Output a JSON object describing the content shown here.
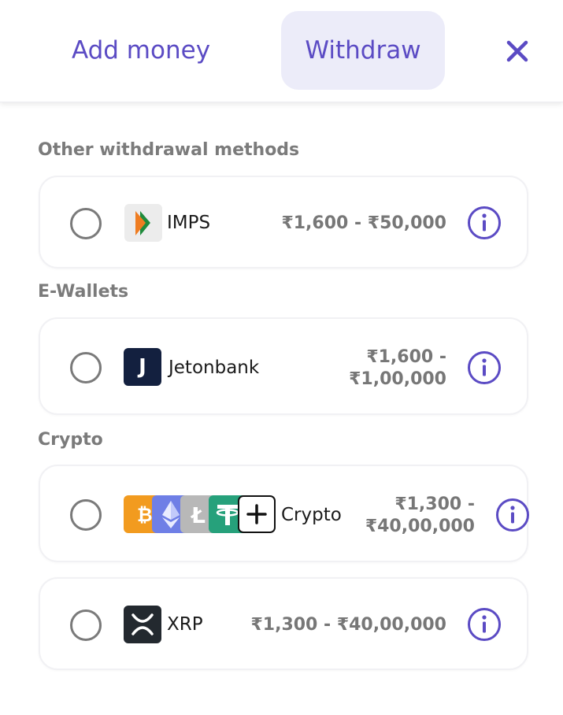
{
  "header": {
    "tabs": [
      {
        "label": "Add money",
        "active": false
      },
      {
        "label": "Withdraw",
        "active": true
      }
    ]
  },
  "sections": {
    "other": {
      "title": "Other withdrawal methods"
    },
    "ewallets": {
      "title": "E-Wallets"
    },
    "crypto": {
      "title": "Crypto"
    }
  },
  "methods": {
    "imps": {
      "name": "IMPS",
      "range": "₹1,600 - ₹50,000",
      "icon": "imps-logo-icon"
    },
    "jetonbank": {
      "name": "Jetonbank",
      "range_line1": "₹1,600 -",
      "range_line2": "₹1,00,000",
      "icon": "jetonbank-logo-icon",
      "logo_letter": "J"
    },
    "crypto": {
      "name": "Crypto",
      "range_line1": "₹1,300 -",
      "range_line2": "₹40,00,000",
      "icons": [
        "bitcoin-icon",
        "ethereum-icon",
        "litecoin-icon",
        "tether-icon",
        "plus-icon"
      ]
    },
    "xrp": {
      "name": "XRP",
      "range": "₹1,300 - ₹40,00,000",
      "icon": "xrp-logo-icon"
    }
  },
  "colors": {
    "accent": "#5b4bc4",
    "tab_active_bg": "#ececf9",
    "muted_text": "#777777"
  }
}
